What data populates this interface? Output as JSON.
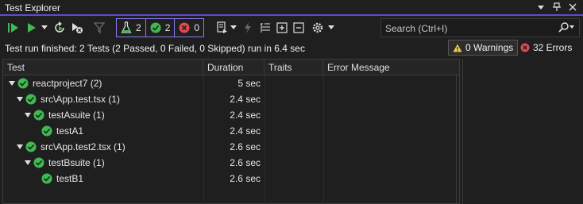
{
  "window": {
    "title": "Test Explorer"
  },
  "toolbar": {
    "counters": [
      {
        "icon": "flask-icon",
        "count": "2"
      },
      {
        "icon": "passed-icon",
        "count": "2"
      },
      {
        "icon": "failed-icon",
        "count": "0"
      }
    ],
    "search_placeholder": "Search (Ctrl+I)"
  },
  "status": {
    "message": "Test run finished: 2 Tests (2 Passed, 0 Failed, 0 Skipped) run in 6.4 sec",
    "warnings": "0 Warnings",
    "errors": "32 Errors"
  },
  "table": {
    "columns": [
      "Test",
      "Duration",
      "Traits",
      "Error Message"
    ],
    "rows": [
      {
        "name": "reactproject7 (2)",
        "duration": "5 sec",
        "level": 0,
        "expandable": true
      },
      {
        "name": "src\\App.test.tsx (1)",
        "duration": "2.4 sec",
        "level": 1,
        "expandable": true
      },
      {
        "name": "testAsuite (1)",
        "duration": "2.4 sec",
        "level": 2,
        "expandable": true
      },
      {
        "name": "testA1",
        "duration": "2.4 sec",
        "level": 3,
        "expandable": false
      },
      {
        "name": "src\\App.test2.tsx (1)",
        "duration": "2.6 sec",
        "level": 1,
        "expandable": true
      },
      {
        "name": "testBsuite (1)",
        "duration": "2.6 sec",
        "level": 2,
        "expandable": true
      },
      {
        "name": "testB1",
        "duration": "2.6 sec",
        "level": 3,
        "expandable": false
      }
    ]
  },
  "colors": {
    "accent": "#5c4bd6",
    "passed": "#3fb950",
    "failed": "#e5484d",
    "warning": "#f2c94c"
  }
}
